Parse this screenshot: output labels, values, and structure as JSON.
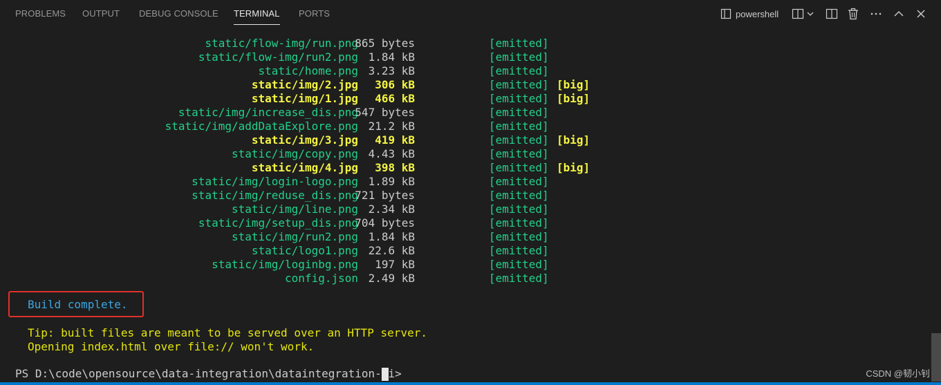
{
  "panel": {
    "tabs": [
      "PROBLEMS",
      "OUTPUT",
      "DEBUG CONSOLE",
      "TERMINAL",
      "PORTS"
    ],
    "active_tab": "TERMINAL",
    "shell_name": "powershell",
    "icons": [
      "terminal-icon",
      "split-terminal-icon",
      "chevron-down-icon",
      "layout-icon",
      "trash-icon",
      "more-icon",
      "chevron-up-icon",
      "close-icon"
    ]
  },
  "terminal": {
    "rows": [
      {
        "name": "static/flow-img/run.png",
        "size": "865 bytes",
        "status": "[emitted]",
        "flag": ""
      },
      {
        "name": "static/flow-img/run2.png",
        "size": "1.84 kB",
        "status": "[emitted]",
        "flag": ""
      },
      {
        "name": "static/home.png",
        "size": "3.23 kB",
        "status": "[emitted]",
        "flag": ""
      },
      {
        "name": "static/img/2.jpg",
        "size": "306 kB",
        "status": "[emitted]",
        "flag": "[big]"
      },
      {
        "name": "static/img/1.jpg",
        "size": "466 kB",
        "status": "[emitted]",
        "flag": "[big]"
      },
      {
        "name": "static/img/increase_dis.png",
        "size": "547 bytes",
        "status": "[emitted]",
        "flag": ""
      },
      {
        "name": "static/img/addDataExplore.png",
        "size": "21.2 kB",
        "status": "[emitted]",
        "flag": ""
      },
      {
        "name": "static/img/3.jpg",
        "size": "419 kB",
        "status": "[emitted]",
        "flag": "[big]"
      },
      {
        "name": "static/img/copy.png",
        "size": "4.43 kB",
        "status": "[emitted]",
        "flag": ""
      },
      {
        "name": "static/img/4.jpg",
        "size": "398 kB",
        "status": "[emitted]",
        "flag": "[big]"
      },
      {
        "name": "static/img/login-logo.png",
        "size": "1.89 kB",
        "status": "[emitted]",
        "flag": ""
      },
      {
        "name": "static/img/reduse_dis.png",
        "size": "721 bytes",
        "status": "[emitted]",
        "flag": ""
      },
      {
        "name": "static/img/line.png",
        "size": "2.34 kB",
        "status": "[emitted]",
        "flag": ""
      },
      {
        "name": "static/img/setup_dis.png",
        "size": "704 bytes",
        "status": "[emitted]",
        "flag": ""
      },
      {
        "name": "static/img/run2.png",
        "size": "1.84 kB",
        "status": "[emitted]",
        "flag": ""
      },
      {
        "name": "static/logo1.png",
        "size": "22.6 kB",
        "status": "[emitted]",
        "flag": ""
      },
      {
        "name": "static/img/loginbg.png",
        "size": "197 kB",
        "status": "[emitted]",
        "flag": ""
      },
      {
        "name": "config.json",
        "size": "2.49 kB",
        "status": "[emitted]",
        "flag": ""
      }
    ],
    "build_message": "Build complete.",
    "tip_lines": [
      "Tip: built files are meant to be served over an HTTP server.",
      "Opening index.html over file:// won't work."
    ],
    "prompt": "PS D:\\code\\opensource\\data-integration\\dataintegration-ui> "
  },
  "watermark": "CSDN @韧小钊",
  "colors": {
    "background": "#1e1e1e",
    "emitted_green": "#23d18b",
    "big_yellow": "#f5f543",
    "build_blue": "#3ba7e0",
    "tip_yellow": "#e5e510",
    "highlight_red": "#e0312a"
  }
}
